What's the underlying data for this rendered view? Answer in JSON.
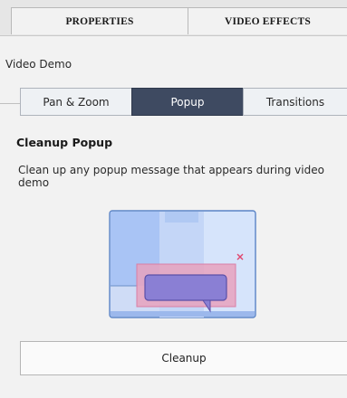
{
  "top_tabs": [
    {
      "label": "PROPERTIES"
    },
    {
      "label": "VIDEO EFFECTS"
    }
  ],
  "section_label": "Video Demo",
  "segments": [
    {
      "label": "Pan & Zoom"
    },
    {
      "label": "Popup"
    },
    {
      "label": "Transitions"
    }
  ],
  "selected_segment": "Popup",
  "panel": {
    "heading": "Cleanup Popup",
    "description": "Clean up any popup message that appears during video demo",
    "button_label": "Cleanup"
  },
  "colors": {
    "selected_segment_bg": "#3e4a61",
    "illustration_blue": "#a9c4f5",
    "highlight_pink": "#e8a2bd",
    "bubble_purple": "#8a7fd4"
  },
  "icons": [
    "popup-illustration-icon",
    "close-x-icon"
  ]
}
